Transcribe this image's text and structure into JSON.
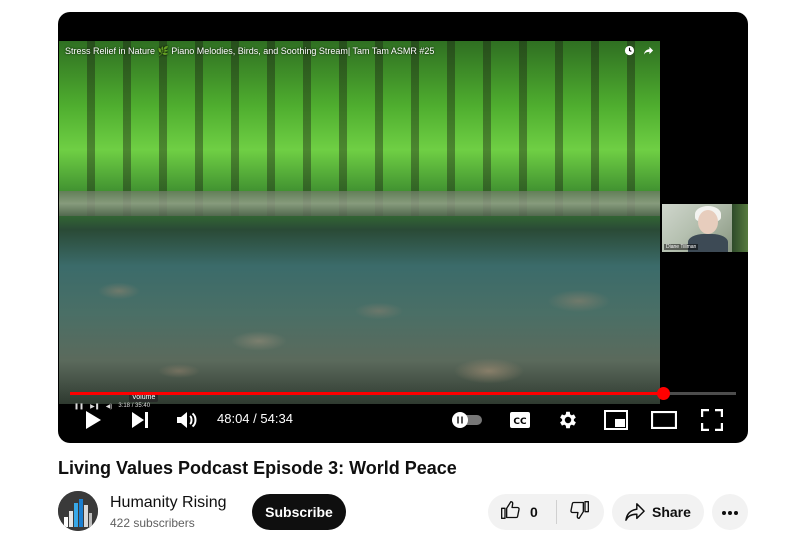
{
  "player": {
    "embedded_title": "Stress Relief in Nature 🌿 Piano Melodies, Birds, and Soothing Stream| Tam Tam ASMR #25",
    "thumbnail_name": "Diane Tillman",
    "inner_tooltip": "Volume",
    "inner_time": "3:18 / 35:40",
    "progress_fraction": 0.89,
    "current_time": "48:04",
    "separator": "/",
    "duration": "54:34",
    "accent_color": "#ff0000"
  },
  "video": {
    "title": "Living Values Podcast Episode 3: World Peace"
  },
  "channel": {
    "name": "Humanity Rising",
    "subscribers": "422 subscribers",
    "subscribe_label": "Subscribe"
  },
  "actions": {
    "like_count": "0",
    "share_label": "Share"
  },
  "icons": {
    "play": "play-icon",
    "next": "next-icon",
    "volume": "volume-icon",
    "autoplay": "autoplay-toggle-icon",
    "captions": "captions-icon",
    "settings": "gear-icon",
    "miniplayer": "miniplayer-icon",
    "theater": "theater-icon",
    "fullscreen": "fullscreen-icon",
    "like": "thumbs-up-icon",
    "dislike": "thumbs-down-icon",
    "share": "share-icon",
    "more": "more-icon"
  }
}
